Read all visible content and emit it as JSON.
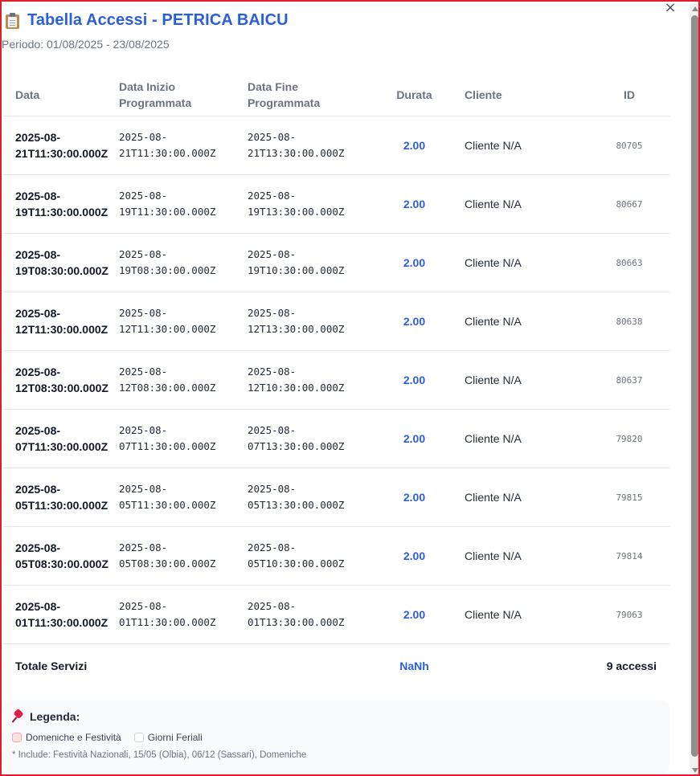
{
  "modal": {
    "title": "Tabella Accessi - PETRICA BAICU",
    "period": "Periodo: 01/08/2025 - 23/08/2025",
    "close_glyph": "×",
    "title_icon": "clipboard-icon"
  },
  "table": {
    "headers": {
      "data": "Data",
      "inizio_line1": "Data Inizio",
      "inizio_line2": "Programmata",
      "fine_line1": "Data Fine",
      "fine_line2": "Programmata",
      "durata": "Durata",
      "cliente": "Cliente",
      "id": "ID"
    },
    "rows": [
      {
        "data1": "2025-08-",
        "data2": "21T11:30:00.000Z",
        "inizio1": "2025-08-",
        "inizio2": "21T11:30:00.000Z",
        "fine1": "2025-08-",
        "fine2": "21T13:30:00.000Z",
        "durata": "2.00",
        "cliente": "Cliente N/A",
        "id": "80705"
      },
      {
        "data1": "2025-08-",
        "data2": "19T11:30:00.000Z",
        "inizio1": "2025-08-",
        "inizio2": "19T11:30:00.000Z",
        "fine1": "2025-08-",
        "fine2": "19T13:30:00.000Z",
        "durata": "2.00",
        "cliente": "Cliente N/A",
        "id": "80667"
      },
      {
        "data1": "2025-08-",
        "data2": "19T08:30:00.000Z",
        "inizio1": "2025-08-",
        "inizio2": "19T08:30:00.000Z",
        "fine1": "2025-08-",
        "fine2": "19T10:30:00.000Z",
        "durata": "2.00",
        "cliente": "Cliente N/A",
        "id": "80663"
      },
      {
        "data1": "2025-08-",
        "data2": "12T11:30:00.000Z",
        "inizio1": "2025-08-",
        "inizio2": "12T11:30:00.000Z",
        "fine1": "2025-08-",
        "fine2": "12T13:30:00.000Z",
        "durata": "2.00",
        "cliente": "Cliente N/A",
        "id": "80638"
      },
      {
        "data1": "2025-08-",
        "data2": "12T08:30:00.000Z",
        "inizio1": "2025-08-",
        "inizio2": "12T08:30:00.000Z",
        "fine1": "2025-08-",
        "fine2": "12T10:30:00.000Z",
        "durata": "2.00",
        "cliente": "Cliente N/A",
        "id": "80637"
      },
      {
        "data1": "2025-08-",
        "data2": "07T11:30:00.000Z",
        "inizio1": "2025-08-",
        "inizio2": "07T11:30:00.000Z",
        "fine1": "2025-08-",
        "fine2": "07T13:30:00.000Z",
        "durata": "2.00",
        "cliente": "Cliente N/A",
        "id": "79820"
      },
      {
        "data1": "2025-08-",
        "data2": "05T11:30:00.000Z",
        "inizio1": "2025-08-",
        "inizio2": "05T11:30:00.000Z",
        "fine1": "2025-08-",
        "fine2": "05T13:30:00.000Z",
        "durata": "2.00",
        "cliente": "Cliente N/A",
        "id": "79815"
      },
      {
        "data1": "2025-08-",
        "data2": "05T08:30:00.000Z",
        "inizio1": "2025-08-",
        "inizio2": "05T08:30:00.000Z",
        "fine1": "2025-08-",
        "fine2": "05T10:30:00.000Z",
        "durata": "2.00",
        "cliente": "Cliente N/A",
        "id": "79814"
      },
      {
        "data1": "2025-08-",
        "data2": "01T11:30:00.000Z",
        "inizio1": "2025-08-",
        "inizio2": "01T11:30:00.000Z",
        "fine1": "2025-08-",
        "fine2": "01T13:30:00.000Z",
        "durata": "2.00",
        "cliente": "Cliente N/A",
        "id": "79063"
      }
    ],
    "totals": {
      "label": "Totale Servizi",
      "hours": "NaNh",
      "count": "9 accessi"
    }
  },
  "legend": {
    "icon": "pushpin-icon",
    "title": "Legenda:",
    "items": [
      {
        "label": "Domeniche e Festività",
        "color": "#fde2e4"
      },
      {
        "label": "Giorni Feriali",
        "color": "#ffffff"
      }
    ],
    "note": "* Include: Festività Nazionali, 15/05 (Olbia), 06/12 (Sassari), Domeniche"
  },
  "colors": {
    "accent": "#2b5fd9",
    "frame_border": "#e11d2a"
  }
}
